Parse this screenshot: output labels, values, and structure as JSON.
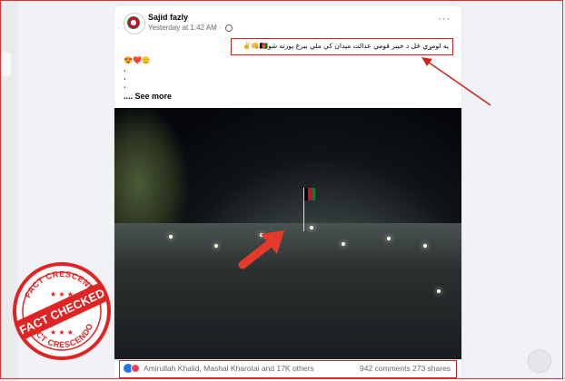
{
  "post": {
    "author": "Sajid fazly",
    "timestamp": "Yesterday at 1:42 AM",
    "privacy_icon": "globe-icon",
    "more_label": "···",
    "text_pashto": "په لومړي ځل د خیبر قومي عدالت میدان کې ملي بیرغ پورته شو🇦🇫👊✌️",
    "emoji_line": "😍❤️🫡",
    "dot_line_1": "،",
    "dot_line_2": "،",
    "dot_line_3": "،",
    "see_more": ".... See more"
  },
  "reactions": {
    "names": "Amirullah Khalid, Mashal Kharotai and 17K others",
    "comments": "942 comments",
    "shares": "273 shares"
  },
  "stamp": {
    "top_text": "FACT CRESCENDO",
    "main_text": "FACT CHECKED",
    "bottom_text": "FACT CRESCENDO"
  },
  "colors": {
    "highlight_red": "#d0231f",
    "facebook_blue": "#1877f2",
    "stamp_red": "#e02424"
  }
}
